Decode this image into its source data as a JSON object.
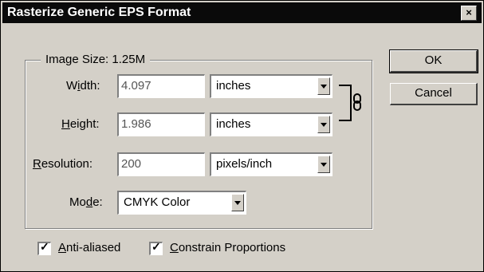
{
  "dialog": {
    "title": "Rasterize Generic EPS Format",
    "close_glyph": "×"
  },
  "image_size": {
    "label": "Image Size: 1.25M"
  },
  "width": {
    "label_pre": "W",
    "label_key": "i",
    "label_post": "dth:",
    "value": "4.097",
    "unit": "inches"
  },
  "height": {
    "label_key": "H",
    "label_post": "eight:",
    "value": "1.986",
    "unit": "inches"
  },
  "resolution": {
    "label_key": "R",
    "label_post": "esolution:",
    "value": "200",
    "unit": "pixels/inch"
  },
  "mode": {
    "label_pre": "Mo",
    "label_key": "d",
    "label_post": "e:",
    "value": "CMYK Color"
  },
  "buttons": {
    "ok": "OK",
    "cancel": "Cancel"
  },
  "checkboxes": {
    "anti_aliased": {
      "key": "A",
      "rest": "nti-aliased",
      "checked": true,
      "mark": "✓"
    },
    "constrain": {
      "key": "C",
      "rest": "onstrain Proportions",
      "checked": true,
      "mark": "✓"
    }
  },
  "icons": {
    "link": "chain-link-icon"
  }
}
